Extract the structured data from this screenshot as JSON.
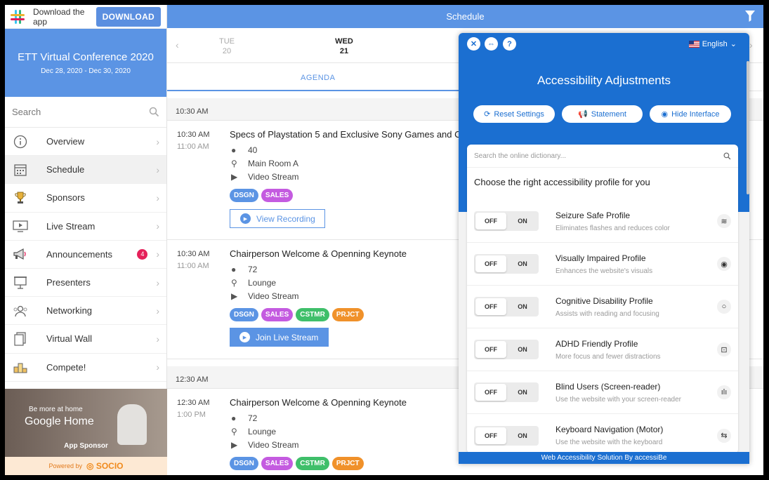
{
  "download_bar": {
    "text": "Download the app",
    "button": "DOWNLOAD"
  },
  "conference": {
    "title": "ETT Virtual Conference 2020",
    "dates": "Dec 28, 2020 - Dec 30, 2020"
  },
  "search": {
    "placeholder": "Search"
  },
  "nav": [
    {
      "label": "Overview",
      "icon": "info-icon"
    },
    {
      "label": "Schedule",
      "icon": "calendar-icon",
      "active": true
    },
    {
      "label": "Sponsors",
      "icon": "trophy-icon"
    },
    {
      "label": "Live Stream",
      "icon": "monitor-icon"
    },
    {
      "label": "Announcements",
      "icon": "megaphone-icon",
      "badge": "4"
    },
    {
      "label": "Presenters",
      "icon": "presentation-board-icon"
    },
    {
      "label": "Networking",
      "icon": "people-icon"
    },
    {
      "label": "Virtual Wall",
      "icon": "photos-icon"
    },
    {
      "label": "Compete!",
      "icon": "leaderboard-icon"
    }
  ],
  "sponsor": {
    "small": "Be more at home",
    "big": "Google Home",
    "label": "App Sponsor"
  },
  "powered": {
    "text": "Powered by",
    "brand": "SOCIO"
  },
  "header": {
    "title": "Schedule"
  },
  "days": [
    {
      "weekday": "TUE",
      "date": "20",
      "active": false
    },
    {
      "weekday": "WED",
      "date": "21",
      "active": true
    }
  ],
  "tabs": {
    "agenda": "AGENDA"
  },
  "time_groups": [
    {
      "header": "10:30 AM",
      "sessions": [
        {
          "start": "10:30 AM",
          "end": "11:00 AM",
          "title": "Specs of Playstation 5 and Exclusive Sony Games and Co",
          "attendees": "40",
          "location": "Main Room A",
          "stream": "Video Stream",
          "tags": [
            "DSGN",
            "SALES"
          ],
          "button": "View Recording",
          "button_style": "outline"
        },
        {
          "start": "10:30 AM",
          "end": "11:00 AM",
          "title": "Chairperson Welcome & Openning Keynote",
          "attendees": "72",
          "location": "Lounge",
          "stream": "Video Stream",
          "tags": [
            "DSGN",
            "SALES",
            "CSTMR",
            "PRJCT"
          ],
          "button": "Join Live Stream",
          "button_style": "solid"
        }
      ]
    },
    {
      "header": "12:30 AM",
      "sessions": [
        {
          "start": "12:30 AM",
          "end": "1:00 PM",
          "title": "Chairperson Welcome & Openning Keynote",
          "attendees": "72",
          "location": "Lounge",
          "stream": "Video Stream",
          "tags": [
            "DSGN",
            "SALES",
            "CSTMR",
            "PRJCT"
          ]
        }
      ]
    }
  ],
  "tag_colors": {
    "DSGN": "#5b94e4",
    "SALES": "#c45be0",
    "CSTMR": "#3fbf6a",
    "PRJCT": "#f0912a"
  },
  "accessibility": {
    "language": "English",
    "title": "Accessibility Adjustments",
    "buttons": {
      "reset": "Reset Settings",
      "statement": "Statement",
      "hide": "Hide Interface"
    },
    "dictionary_placeholder": "Search the online dictionary...",
    "choose_text": "Choose the right accessibility profile for you",
    "toggle": {
      "off": "OFF",
      "on": "ON"
    },
    "profiles": [
      {
        "name": "Seizure Safe Profile",
        "desc": "Eliminates flashes and reduces color",
        "icon": "no-flash-icon"
      },
      {
        "name": "Visually Impaired Profile",
        "desc": "Enhances the website's visuals",
        "icon": "eye-icon"
      },
      {
        "name": "Cognitive Disability Profile",
        "desc": "Assists with reading and focusing",
        "icon": "brain-icon"
      },
      {
        "name": "ADHD Friendly Profile",
        "desc": "More focus and fewer distractions",
        "icon": "focus-target-icon"
      },
      {
        "name": "Blind Users (Screen-reader)",
        "desc": "Use the website with your screen-reader",
        "icon": "audio-wave-icon"
      },
      {
        "name": "Keyboard Navigation (Motor)",
        "desc": "Use the website with the keyboard",
        "icon": "arrows-swap-icon"
      }
    ],
    "footer": "Web Accessibility Solution By accessiBe"
  },
  "colors": {
    "brand_blue": "#5b94e4",
    "acc_blue": "#1b6fd1",
    "badge_red": "#e5215a"
  }
}
